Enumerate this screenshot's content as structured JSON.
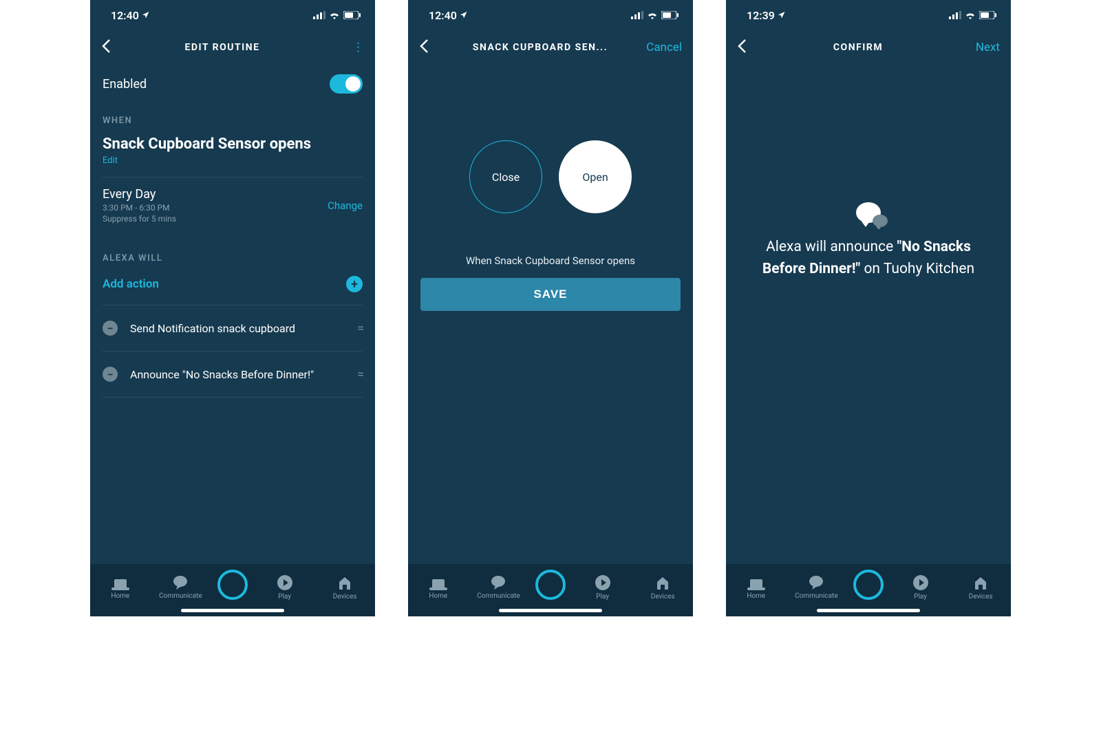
{
  "status": {
    "time_a": "12:40",
    "time_b": "12:40",
    "time_c": "12:39"
  },
  "screen1": {
    "header_title": "EDIT ROUTINE",
    "enabled_label": "Enabled",
    "when_label": "WHEN",
    "trigger_title": "Snack Cupboard Sensor opens",
    "edit_link": "Edit",
    "schedule_headline": "Every Day",
    "schedule_time": "3:30 PM - 6:30 PM",
    "schedule_suppress": "Suppress for 5 mins",
    "change_link": "Change",
    "alexa_will_label": "ALEXA WILL",
    "add_action_label": "Add action",
    "actions": [
      {
        "text": "Send Notification snack cupboard"
      },
      {
        "text": "Announce \"No Snacks Before Dinner!\""
      }
    ]
  },
  "screen2": {
    "header_title": "SNACK CUPBOARD SEN...",
    "cancel": "Cancel",
    "close_label": "Close",
    "open_label": "Open",
    "when_text": "When Snack Cupboard Sensor opens",
    "save_label": "SAVE"
  },
  "screen3": {
    "header_title": "CONFIRM",
    "next": "Next",
    "confirm_pre": "Alexa will announce ",
    "confirm_bold": "\"No Snacks Before Dinner!\"",
    "confirm_post": " on Tuohy Kitchen"
  },
  "nav": {
    "home": "Home",
    "communicate": "Communicate",
    "play": "Play",
    "devices": "Devices"
  }
}
